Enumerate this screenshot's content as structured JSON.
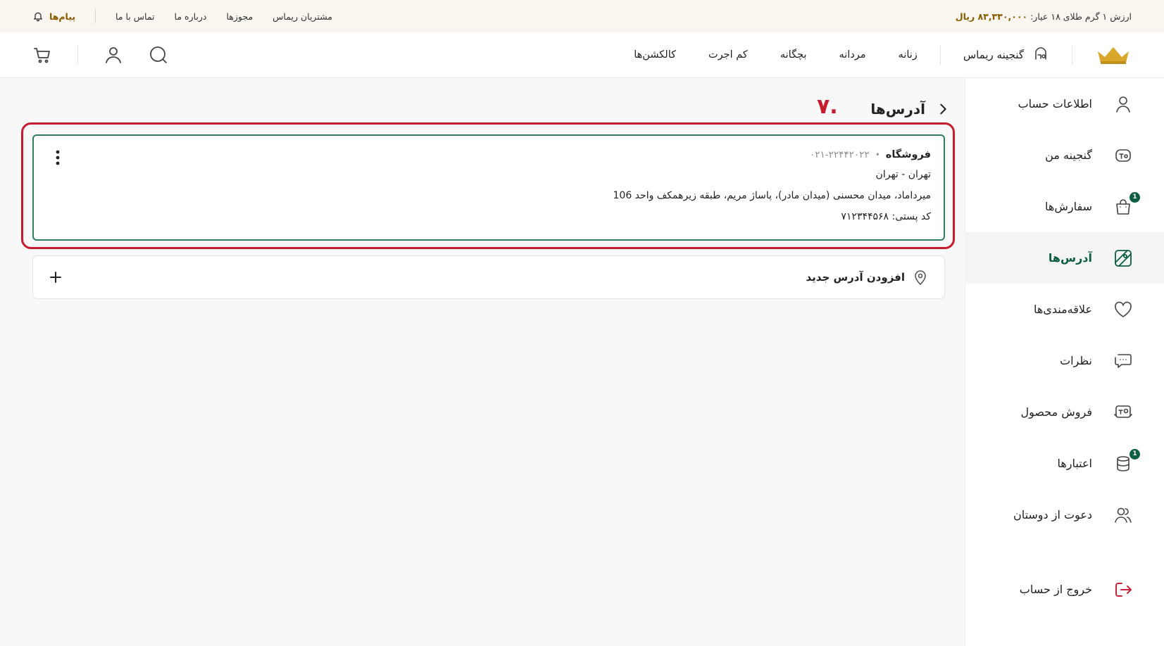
{
  "topbar": {
    "gold_label": "ارزش ۱ گرم طلای ۱۸ عیار:",
    "gold_value": "۸۳,۳۳۰,۰۰۰ ریال",
    "links": [
      "مشتریان ریماس",
      "مجوزها",
      "درباره ما",
      "تماس با ما"
    ],
    "messages_label": "پیام‌ها"
  },
  "nav": {
    "treasure_label": "گنجینه ریماس",
    "links": [
      "زنانه",
      "مردانه",
      "بچگانه",
      "کم اجرت",
      "کالکشن‌ها"
    ]
  },
  "page": {
    "title": "آدرس‌ها",
    "step_number": "۷."
  },
  "address": {
    "name": "فروشگاه",
    "phone": "۰۲۱-۲۲۴۴۲۰۲۲",
    "city": "تهران - تهران",
    "full_address": "میرداماد، میدان محسنی (میدان مادر)، پاساژ مریم، طبقه زیرهمکف واحد 106",
    "postal_code": "کد پستی: ۷۱۲۳۴۴۵۶۸"
  },
  "add_address_label": "افزودن آدرس جدید",
  "sidebar": {
    "items": [
      {
        "label": "اطلاعات حساب",
        "icon": "user-icon"
      },
      {
        "label": "گنجینه من",
        "icon": "treasure-icon"
      },
      {
        "label": "سفارش‌ها",
        "icon": "bag-icon",
        "badge": "1"
      },
      {
        "label": "آدرس‌ها",
        "icon": "map-icon",
        "active": true
      },
      {
        "label": "علاقه‌مندی‌ها",
        "icon": "heart-icon"
      },
      {
        "label": "نظرات",
        "icon": "comments-icon"
      },
      {
        "label": "فروش محصول",
        "icon": "sell-icon"
      },
      {
        "label": "اعتبارها",
        "icon": "coins-icon",
        "badge": "1"
      },
      {
        "label": "دعوت از دوستان",
        "icon": "users-icon"
      }
    ],
    "logout_label": "خروج از حساب"
  },
  "colors": {
    "accent_green": "#0b5e40",
    "highlight_red": "#c61c2e",
    "gold": "#8a5a00",
    "logo_gold": "#d9a82a"
  }
}
